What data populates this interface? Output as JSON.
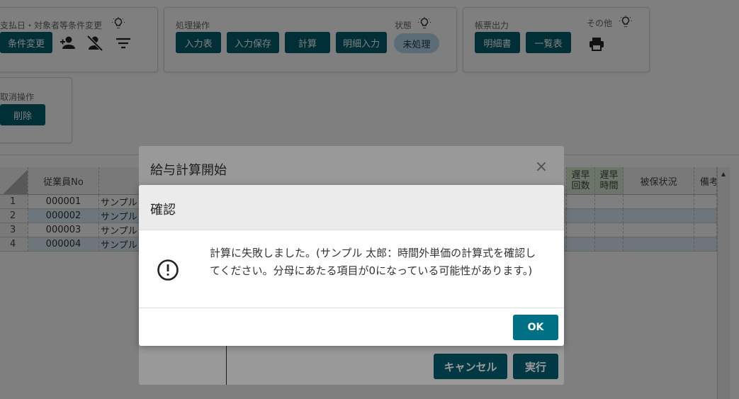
{
  "panels": {
    "conditions": {
      "title": "支払日・対象者等条件変更",
      "button": "条件変更"
    },
    "processing": {
      "title": "処理操作",
      "status_label": "状態",
      "status_value": "未処理",
      "buttons": [
        "入力表",
        "入力保存",
        "計算",
        "明細入力"
      ]
    },
    "reports": {
      "title": "帳票出力",
      "other_label": "その他",
      "buttons": [
        "明細書",
        "一覧表"
      ]
    },
    "cancel": {
      "title": "取消操作",
      "button": "削除"
    }
  },
  "grid": {
    "headers": {
      "employee_no": "従業員No",
      "late_early_count": "遅早回数",
      "late_early_time": "遅早時間",
      "insured_status": "被保状況",
      "remarks": "備考"
    },
    "rows": [
      {
        "num": "1",
        "emp_no": "000001",
        "name": "サンプル"
      },
      {
        "num": "2",
        "emp_no": "000002",
        "name": "サンプル"
      },
      {
        "num": "3",
        "emp_no": "000003",
        "name": "サンプル"
      },
      {
        "num": "4",
        "emp_no": "000004",
        "name": "サンプル"
      }
    ]
  },
  "outer_dialog": {
    "title": "給与計算開始",
    "close_glyph": "×",
    "cancel_label": "キャンセル",
    "execute_label": "実行"
  },
  "confirm_dialog": {
    "title": "確認",
    "message": "計算に失敗しました。(サンプル 太郎：時間外単価の計算式を確認してください。分母にあたる項目が0になっている可能性があります。)",
    "ok_label": "OK"
  },
  "colors": {
    "primary": "#005f70",
    "ok_button": "#007185",
    "row_alt": "#d9ecf7",
    "status_pill": "#b9d8ee",
    "header_green": "#d6ead0"
  },
  "icons": [
    "lightbulb-icon",
    "person-add-icon",
    "person-off-icon",
    "filter-list-icon",
    "print-icon",
    "alert-circle-icon",
    "close-icon",
    "scroll-up-icon"
  ]
}
